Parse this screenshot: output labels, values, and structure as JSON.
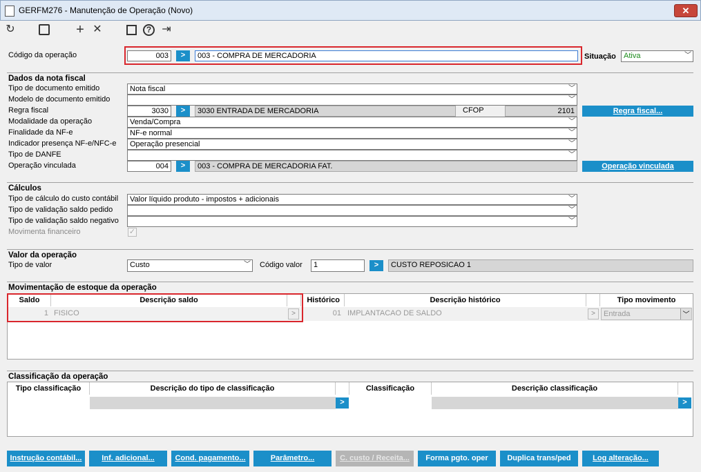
{
  "window": {
    "title": "GERFM276 - Manutenção de Operação (Novo)",
    "close": "✕"
  },
  "toolbar": {
    "refresh": "↻",
    "save": "💾",
    "add": "+",
    "delete": "✕",
    "calendar": "📅",
    "help": "?",
    "exit": "⇥"
  },
  "codigo": {
    "label": "Código da operação",
    "code": "003",
    "go": ">",
    "desc": "003 - COMPRA DE MERCADORIA"
  },
  "situacao": {
    "label": "Situação",
    "value": "Ativa",
    "value_color": "#1a8a1a"
  },
  "nota": {
    "title": "Dados da nota fiscal",
    "tipo_doc_label": "Tipo de documento emitido",
    "tipo_doc": "Nota fiscal",
    "modelo_label": "Modelo de documento emitido",
    "modelo": "",
    "regra_label": "Regra fiscal",
    "regra_code": "3030",
    "regra_desc": "3030 ENTRADA DE MERCADORIA",
    "cfop_label": "CFOP",
    "cfop": "2101",
    "regra_btn": "Regra fiscal...",
    "modalidade_label": "Modalidade da operação",
    "modalidade": "Venda/Compra",
    "finalidade_label": "Finalidade da NF-e",
    "finalidade": "NF-e normal",
    "indicador_label": "Indicador presença NF-e/NFC-e",
    "indicador": "Operação presencial",
    "danfe_label": "Tipo de DANFE",
    "danfe": "",
    "vinculada_label": "Operação vinculada",
    "vinculada_code": "004",
    "vinculada_desc": "003 - COMPRA DE MERCADORIA FAT.",
    "vinculada_btn": "Operação vinculada"
  },
  "calculos": {
    "title": "Cálculos",
    "custo_label": "Tipo de cálculo do custo contábil",
    "custo": "Valor líquido produto - impostos + adicionais",
    "pedido_label": "Tipo de validação saldo pedido",
    "pedido": "",
    "negativo_label": "Tipo de validação saldo negativo",
    "negativo": "",
    "fin_label": "Movimenta financeiro",
    "fin_checked": true
  },
  "valor": {
    "title": "Valor da operação",
    "tipo_label": "Tipo de valor",
    "tipo": "Custo",
    "codigo_label": "Código valor",
    "codigo": "1",
    "desc": "CUSTO REPOSICAO 1"
  },
  "estoque": {
    "title": "Movimentação de estoque da operação",
    "headers": [
      "Saldo",
      "Descrição saldo",
      "Histórico",
      "Descrição histórico",
      "Tipo movimento"
    ],
    "row": {
      "saldo": "1",
      "desc": "FISICO",
      "hist": "01",
      "hist_desc": "IMPLANTACAO DE SALDO",
      "tipo": "Entrada"
    }
  },
  "classificacao": {
    "title": "Classificação da operação",
    "headers": [
      "Tipo classificação",
      "Descrição do tipo de classificação",
      "Classificação",
      "Descrição classificação"
    ]
  },
  "buttons": [
    "Instrução contábil...",
    "Inf. adicional...",
    "Cond. pagamento...",
    "Parâmetro...",
    "C. custo / Receita...",
    "Forma pgto. oper",
    "Duplica trans/ped",
    "Log alteração..."
  ]
}
